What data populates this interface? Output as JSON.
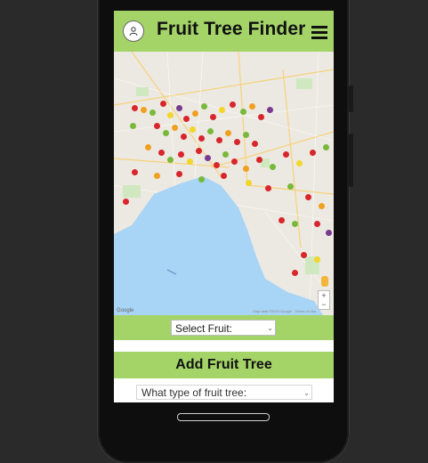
{
  "header": {
    "title": "Fruit Tree Finder"
  },
  "map": {
    "provider_label": "Google",
    "attribution": "Map data ©2019 Google · Terms of Use"
  },
  "fruit_select": {
    "value": "Select Fruit:"
  },
  "add_section": {
    "title": "Add Fruit Tree"
  },
  "tree_select": {
    "value": "What type of fruit tree:"
  },
  "colors": {
    "header_bg": "#a4d468",
    "water": "#a8d4f5",
    "land": "#ece9e2"
  }
}
